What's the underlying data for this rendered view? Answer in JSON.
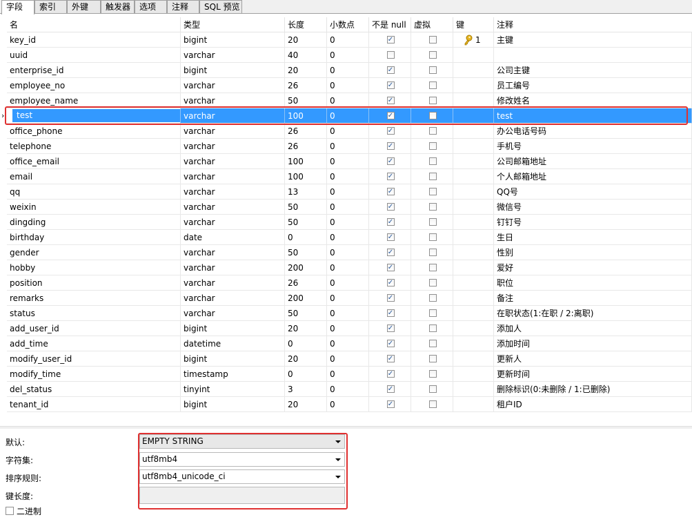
{
  "tabs": [
    "字段",
    "索引",
    "外键",
    "触发器",
    "选项",
    "注释",
    "SQL 预览"
  ],
  "columns": {
    "name": "名",
    "type": "类型",
    "length": "长度",
    "decimals": "小数点",
    "not_null": "不是 null",
    "virtual": "虚拟",
    "key": "键",
    "comment": "注释"
  },
  "rows": [
    {
      "name": "key_id",
      "type": "bigint",
      "length": "20",
      "decimals": "0",
      "not_null": true,
      "virtual": false,
      "key": "1",
      "comment": "主键"
    },
    {
      "name": "uuid",
      "type": "varchar",
      "length": "40",
      "decimals": "0",
      "not_null": false,
      "virtual": false,
      "key": "",
      "comment": ""
    },
    {
      "name": "enterprise_id",
      "type": "bigint",
      "length": "20",
      "decimals": "0",
      "not_null": true,
      "virtual": false,
      "key": "",
      "comment": "公司主键"
    },
    {
      "name": "employee_no",
      "type": "varchar",
      "length": "26",
      "decimals": "0",
      "not_null": true,
      "virtual": false,
      "key": "",
      "comment": "员工编号"
    },
    {
      "name": "employee_name",
      "type": "varchar",
      "length": "50",
      "decimals": "0",
      "not_null": true,
      "virtual": false,
      "key": "",
      "comment": "修改姓名"
    },
    {
      "name": "test",
      "type": "varchar",
      "length": "100",
      "decimals": "0",
      "not_null": true,
      "virtual": false,
      "key": "",
      "comment": "test",
      "selected": true
    },
    {
      "name": "office_phone",
      "type": "varchar",
      "length": "26",
      "decimals": "0",
      "not_null": true,
      "virtual": false,
      "key": "",
      "comment": "办公电话号码"
    },
    {
      "name": "telephone",
      "type": "varchar",
      "length": "26",
      "decimals": "0",
      "not_null": true,
      "virtual": false,
      "key": "",
      "comment": "手机号"
    },
    {
      "name": "office_email",
      "type": "varchar",
      "length": "100",
      "decimals": "0",
      "not_null": true,
      "virtual": false,
      "key": "",
      "comment": "公司邮箱地址"
    },
    {
      "name": "email",
      "type": "varchar",
      "length": "100",
      "decimals": "0",
      "not_null": true,
      "virtual": false,
      "key": "",
      "comment": "个人邮箱地址"
    },
    {
      "name": "qq",
      "type": "varchar",
      "length": "13",
      "decimals": "0",
      "not_null": true,
      "virtual": false,
      "key": "",
      "comment": "QQ号"
    },
    {
      "name": "weixin",
      "type": "varchar",
      "length": "50",
      "decimals": "0",
      "not_null": true,
      "virtual": false,
      "key": "",
      "comment": "微信号"
    },
    {
      "name": "dingding",
      "type": "varchar",
      "length": "50",
      "decimals": "0",
      "not_null": true,
      "virtual": false,
      "key": "",
      "comment": "钉钉号"
    },
    {
      "name": "birthday",
      "type": "date",
      "length": "0",
      "decimals": "0",
      "not_null": true,
      "virtual": false,
      "key": "",
      "comment": "生日"
    },
    {
      "name": "gender",
      "type": "varchar",
      "length": "50",
      "decimals": "0",
      "not_null": true,
      "virtual": false,
      "key": "",
      "comment": "性别"
    },
    {
      "name": "hobby",
      "type": "varchar",
      "length": "200",
      "decimals": "0",
      "not_null": true,
      "virtual": false,
      "key": "",
      "comment": "爱好"
    },
    {
      "name": "position",
      "type": "varchar",
      "length": "26",
      "decimals": "0",
      "not_null": true,
      "virtual": false,
      "key": "",
      "comment": "职位"
    },
    {
      "name": "remarks",
      "type": "varchar",
      "length": "200",
      "decimals": "0",
      "not_null": true,
      "virtual": false,
      "key": "",
      "comment": "备注"
    },
    {
      "name": "status",
      "type": "varchar",
      "length": "50",
      "decimals": "0",
      "not_null": true,
      "virtual": false,
      "key": "",
      "comment": "在职状态(1:在职 / 2:离职)"
    },
    {
      "name": "add_user_id",
      "type": "bigint",
      "length": "20",
      "decimals": "0",
      "not_null": true,
      "virtual": false,
      "key": "",
      "comment": "添加人"
    },
    {
      "name": "add_time",
      "type": "datetime",
      "length": "0",
      "decimals": "0",
      "not_null": true,
      "virtual": false,
      "key": "",
      "comment": "添加时间"
    },
    {
      "name": "modify_user_id",
      "type": "bigint",
      "length": "20",
      "decimals": "0",
      "not_null": true,
      "virtual": false,
      "key": "",
      "comment": "更新人"
    },
    {
      "name": "modify_time",
      "type": "timestamp",
      "length": "0",
      "decimals": "0",
      "not_null": true,
      "virtual": false,
      "key": "",
      "comment": "更新时间"
    },
    {
      "name": "del_status",
      "type": "tinyint",
      "length": "3",
      "decimals": "0",
      "not_null": true,
      "virtual": false,
      "key": "",
      "comment": "删除标识(0:未删除 / 1:已删除)"
    },
    {
      "name": "tenant_id",
      "type": "bigint",
      "length": "20",
      "decimals": "0",
      "not_null": true,
      "virtual": false,
      "key": "",
      "comment": "租户ID"
    }
  ],
  "properties": {
    "default_label": "默认:",
    "default_value": "EMPTY STRING",
    "charset_label": "字符集:",
    "charset_value": "utf8mb4",
    "collation_label": "排序规则:",
    "collation_value": "utf8mb4_unicode_ci",
    "key_length_label": "键长度:",
    "key_length_value": "",
    "binary_label": "二进制",
    "binary_checked": false
  },
  "icons": {
    "key": "key-icon",
    "row_marker": "row-pointer-icon"
  },
  "colors": {
    "selection": "#3399ff",
    "highlight_border": "#e03030"
  }
}
